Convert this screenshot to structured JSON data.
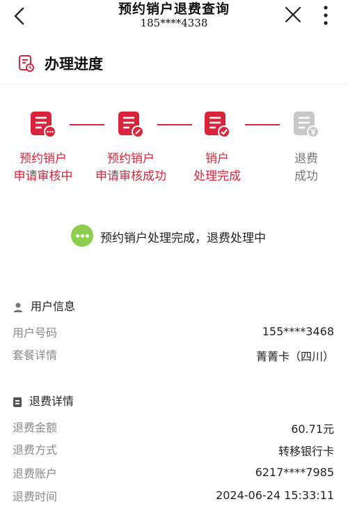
{
  "header": {
    "title": "预约销户退费查询",
    "phone": "185****4338",
    "back_icon": "chevron-left-icon",
    "close_icon": "close-icon",
    "more_icon": "more-vertical-icon"
  },
  "progress_section": {
    "title": "办理进度",
    "icon": "progress-document-icon",
    "accent": "#d9243b",
    "inactive": "#c8c8c8"
  },
  "steps": [
    {
      "line1": "预约销户",
      "line2": "申请审核中",
      "state": "done",
      "icon": "document-pending-icon"
    },
    {
      "line1": "预约销户",
      "line2": "申请审核成功",
      "state": "done",
      "icon": "document-edit-icon"
    },
    {
      "line1": "销户",
      "line2": "处理完成",
      "state": "done",
      "icon": "document-check-icon"
    },
    {
      "line1": "退费",
      "line2": "成功",
      "state": "pending",
      "icon": "document-yuan-icon"
    }
  ],
  "status": {
    "text": "预约销户处理完成，退费处理中",
    "icon": "ellipsis-bubble-icon",
    "color": "#8ccf4d"
  },
  "user_info": {
    "title": "用户信息",
    "icon": "user-icon",
    "rows": [
      {
        "label": "用户号码",
        "value": "155****3468"
      },
      {
        "label": "套餐详情",
        "value": "菁菁卡（四川）"
      }
    ]
  },
  "refund_info": {
    "title": "退费详情",
    "icon": "wallet-icon",
    "rows": [
      {
        "label": "退费金额",
        "value": "60.71元"
      },
      {
        "label": "退费方式",
        "value": "转移银行卡"
      },
      {
        "label": "退费账户",
        "value": "6217****7985"
      },
      {
        "label": "退费时间",
        "value": "2024-06-24 15:33:11"
      }
    ]
  }
}
